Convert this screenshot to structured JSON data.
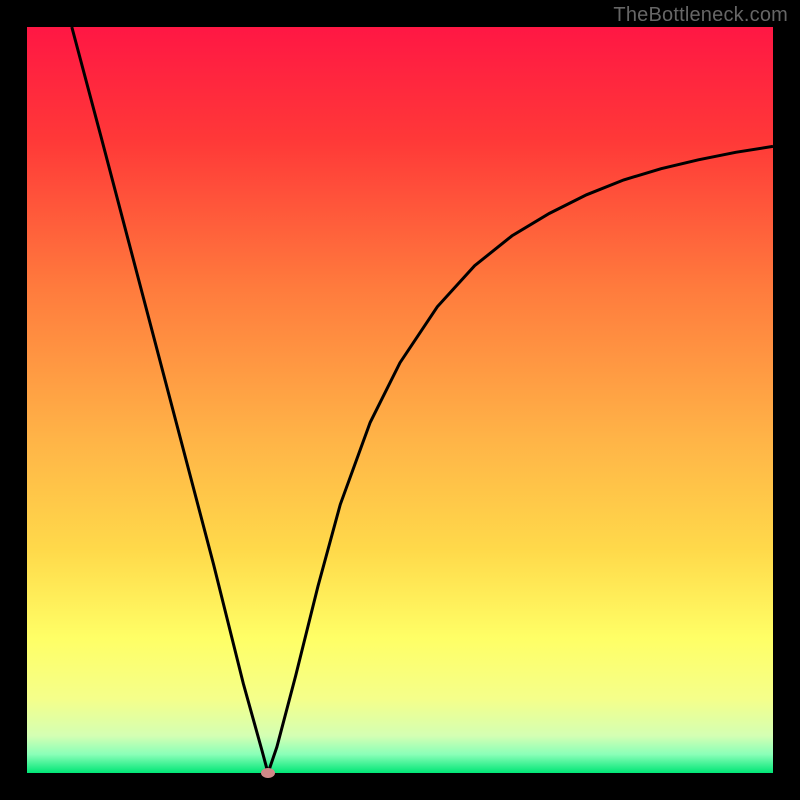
{
  "watermark": "TheBottleneck.com",
  "chart_data": {
    "type": "line",
    "title": "",
    "xlabel": "",
    "ylabel": "",
    "xlim": [
      0,
      1
    ],
    "ylim": [
      0,
      1
    ],
    "gradient_stops": [
      {
        "offset": 0,
        "color": "#ff1744"
      },
      {
        "offset": 0.15,
        "color": "#ff3838"
      },
      {
        "offset": 0.35,
        "color": "#ff7b3d"
      },
      {
        "offset": 0.55,
        "color": "#ffb347"
      },
      {
        "offset": 0.7,
        "color": "#ffd94a"
      },
      {
        "offset": 0.82,
        "color": "#ffff66"
      },
      {
        "offset": 0.9,
        "color": "#f5ff8a"
      },
      {
        "offset": 0.95,
        "color": "#d4ffb3"
      },
      {
        "offset": 0.975,
        "color": "#8affb8"
      },
      {
        "offset": 1.0,
        "color": "#00e676"
      }
    ],
    "series": [
      {
        "name": "bottleneck-curve",
        "description": "V-shaped curve with steep linear left descent and asymptotic right ascent",
        "x": [
          0.06,
          0.1,
          0.15,
          0.2,
          0.25,
          0.29,
          0.315,
          0.323,
          0.335,
          0.36,
          0.39,
          0.42,
          0.46,
          0.5,
          0.55,
          0.6,
          0.65,
          0.7,
          0.75,
          0.8,
          0.85,
          0.9,
          0.95,
          1.0
        ],
        "y": [
          1.0,
          0.85,
          0.66,
          0.47,
          0.28,
          0.12,
          0.03,
          0.0,
          0.035,
          0.13,
          0.25,
          0.36,
          0.47,
          0.55,
          0.625,
          0.68,
          0.72,
          0.75,
          0.775,
          0.795,
          0.81,
          0.822,
          0.832,
          0.84
        ]
      }
    ],
    "marker": {
      "x": 0.323,
      "y": 0.0,
      "color": "#d08888"
    }
  }
}
